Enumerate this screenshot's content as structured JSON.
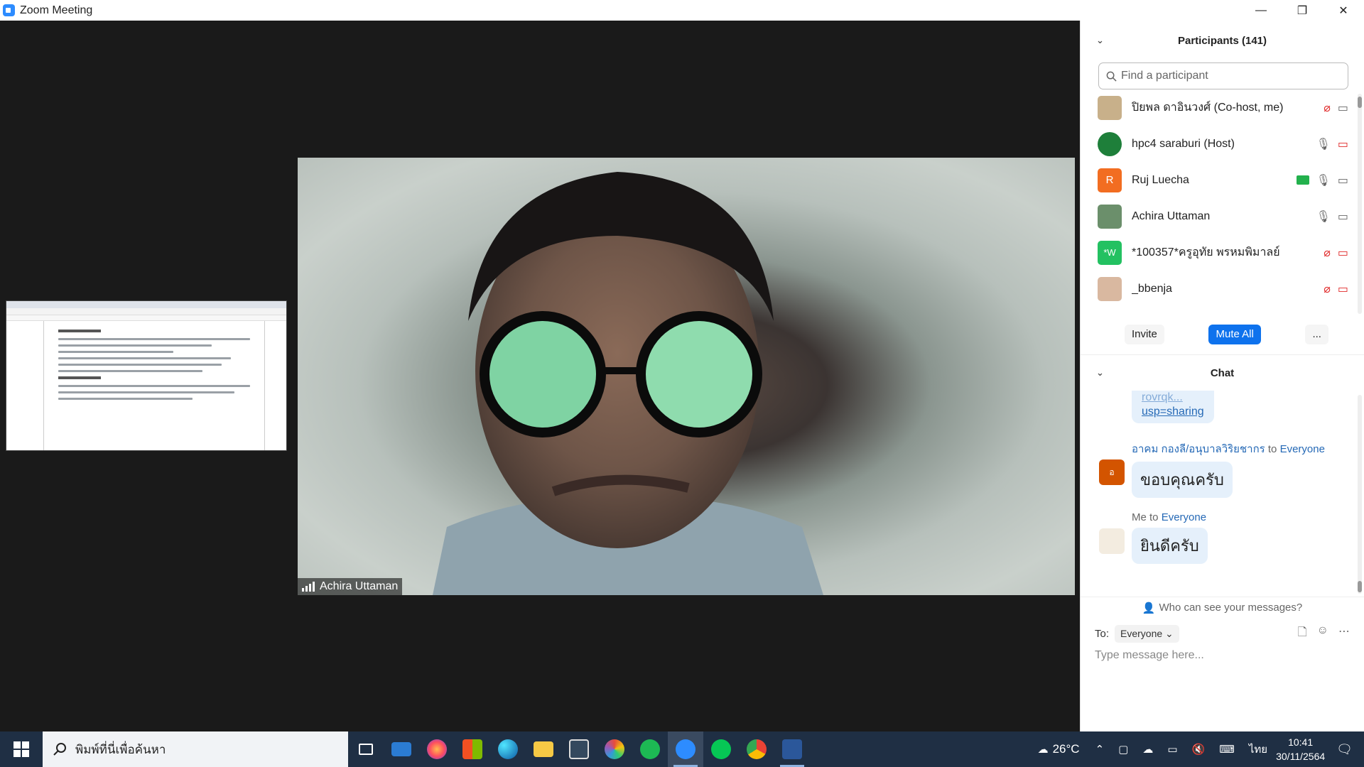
{
  "window": {
    "title": "Zoom Meeting"
  },
  "window_controls": {
    "minimize": "—",
    "restore": "❐",
    "close": "✕"
  },
  "video": {
    "speaker_name": "Achira Uttaman"
  },
  "participants": {
    "header": "Participants (141)",
    "search_placeholder": "Find a participant",
    "items": [
      {
        "name": "ปิยพล ดาอินวงศ์ (Co-host, me)",
        "avatar": "",
        "avatar_color": "#c8b08a"
      },
      {
        "name": "hpc4 saraburi (Host)",
        "avatar": "",
        "avatar_color": "#1e7f3a"
      },
      {
        "name": "Ruj Luecha",
        "avatar": "R",
        "avatar_color": "#f26d21"
      },
      {
        "name": "Achira Uttaman",
        "avatar": "",
        "avatar_color": "#6b8f6b"
      },
      {
        "name": "*100357*ครูอุทัย พรหมพิมาลย์",
        "avatar": "*W",
        "avatar_color": "#23c161"
      },
      {
        "name": "_bbenja",
        "avatar": "",
        "avatar_color": "#d9b8a0"
      }
    ],
    "invite_label": "Invite",
    "mute_all_label": "Mute All",
    "more_label": "..."
  },
  "chat": {
    "header": "Chat",
    "link_fragment_1": "rovrqk...",
    "link_fragment_2": "usp=sharing",
    "messages": [
      {
        "sender": "อาคม กองลี/อนุบาลวิริยชากร",
        "to_word": "to",
        "recipient": "Everyone",
        "text": "ขอบคุณครับ",
        "avatar": "อ",
        "avatar_color": "#d35400"
      },
      {
        "sender": "Me",
        "to_word": "to",
        "recipient": "Everyone",
        "text": "ยินดีครับ",
        "avatar": "",
        "avatar_color": "#ffffff"
      }
    ],
    "who_can_see": "Who can see your messages?",
    "to_label": "To:",
    "to_value": "Everyone",
    "placeholder": "Type message here..."
  },
  "taskbar": {
    "search_placeholder": "พิมพ์ที่นี่เพื่อค้นหา",
    "weather": "26°C",
    "language": "ไทย",
    "time": "10:41",
    "date": "30/11/2564"
  }
}
